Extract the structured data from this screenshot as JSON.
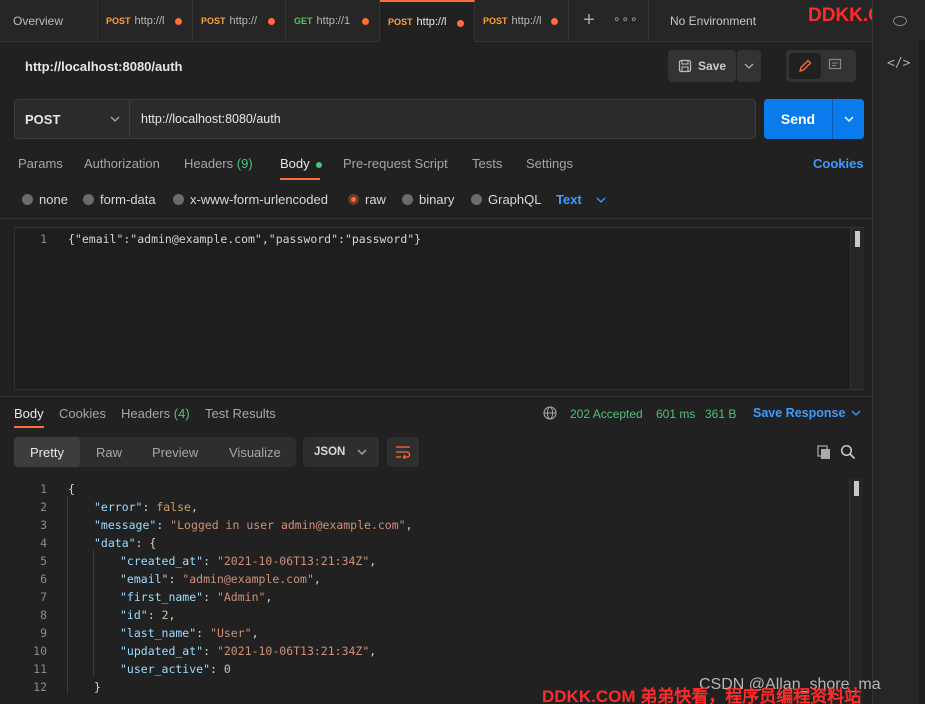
{
  "tabs": [
    {
      "label": "Overview"
    },
    {
      "method": "POST",
      "url": "http://l",
      "method_color": "#ff9f3d"
    },
    {
      "method": "POST",
      "url": "http://",
      "method_color": "#ff9f3d"
    },
    {
      "method": "GET",
      "url": "http://1",
      "method_color": "#5fbf5f"
    },
    {
      "method": "POST",
      "url": "http://l",
      "method_color": "#ff9f3d"
    },
    {
      "method": "POST",
      "url": "http://l",
      "method_color": "#ff9f3d"
    }
  ],
  "environment": "No Environment",
  "watermark_top": "DDKK.COM",
  "watermark_bottom": "DDKK.COM 弟弟快看，程序员编程资料站",
  "csdn_mark": "CSDN @Allan_shore_ma",
  "request": {
    "title": "http://localhost:8080/auth",
    "save_label": "Save",
    "method": "POST",
    "url": "http://localhost:8080/auth",
    "send_label": "Send"
  },
  "request_tabs": {
    "params": "Params",
    "authorization": "Authorization",
    "headers": "Headers",
    "headers_count": "(9)",
    "body": "Body",
    "prerequest": "Pre-request Script",
    "tests": "Tests",
    "settings": "Settings",
    "cookies": "Cookies"
  },
  "body_types": {
    "none": "none",
    "form_data": "form-data",
    "urlencoded": "x-www-form-urlencoded",
    "raw": "raw",
    "binary": "binary",
    "graphql": "GraphQL",
    "format": "Text"
  },
  "request_body": {
    "line_number": "1",
    "content": "{\"email\":\"admin@example.com\",\"password\":\"password\"}"
  },
  "response_tabs": {
    "body": "Body",
    "cookies": "Cookies",
    "headers": "Headers",
    "headers_count": "(4)",
    "test_results": "Test Results"
  },
  "response_status": {
    "status": "202 Accepted",
    "time": "601 ms",
    "size": "361 B",
    "save_response": "Save Response"
  },
  "view_modes": {
    "pretty": "Pretty",
    "raw": "Raw",
    "preview": "Preview",
    "visualize": "Visualize",
    "format": "JSON"
  },
  "response_lines": [
    "1",
    "2",
    "3",
    "4",
    "5",
    "6",
    "7",
    "8",
    "9",
    "10",
    "11",
    "12"
  ],
  "response_json": {
    "error_key": "\"error\"",
    "error_val": "false",
    "message_key": "\"message\"",
    "message_val": "\"Logged in user admin@example.com\"",
    "data_key": "\"data\"",
    "created_at_key": "\"created_at\"",
    "created_at_val": "\"2021-10-06T13:21:34Z\"",
    "email_key": "\"email\"",
    "email_val": "\"admin@example.com\"",
    "first_name_key": "\"first_name\"",
    "first_name_val": "\"Admin\"",
    "id_key": "\"id\"",
    "id_val": "2",
    "last_name_key": "\"last_name\"",
    "last_name_val": "\"User\"",
    "updated_at_key": "\"updated_at\"",
    "updated_at_val": "\"2021-10-06T13:21:34Z\"",
    "user_active_key": "\"user_active\"",
    "user_active_val": "0"
  },
  "colors": {
    "accent": "#ff6c37",
    "send": "#097bed",
    "link": "#3d9bff",
    "status_ok": "#4fc27a"
  }
}
